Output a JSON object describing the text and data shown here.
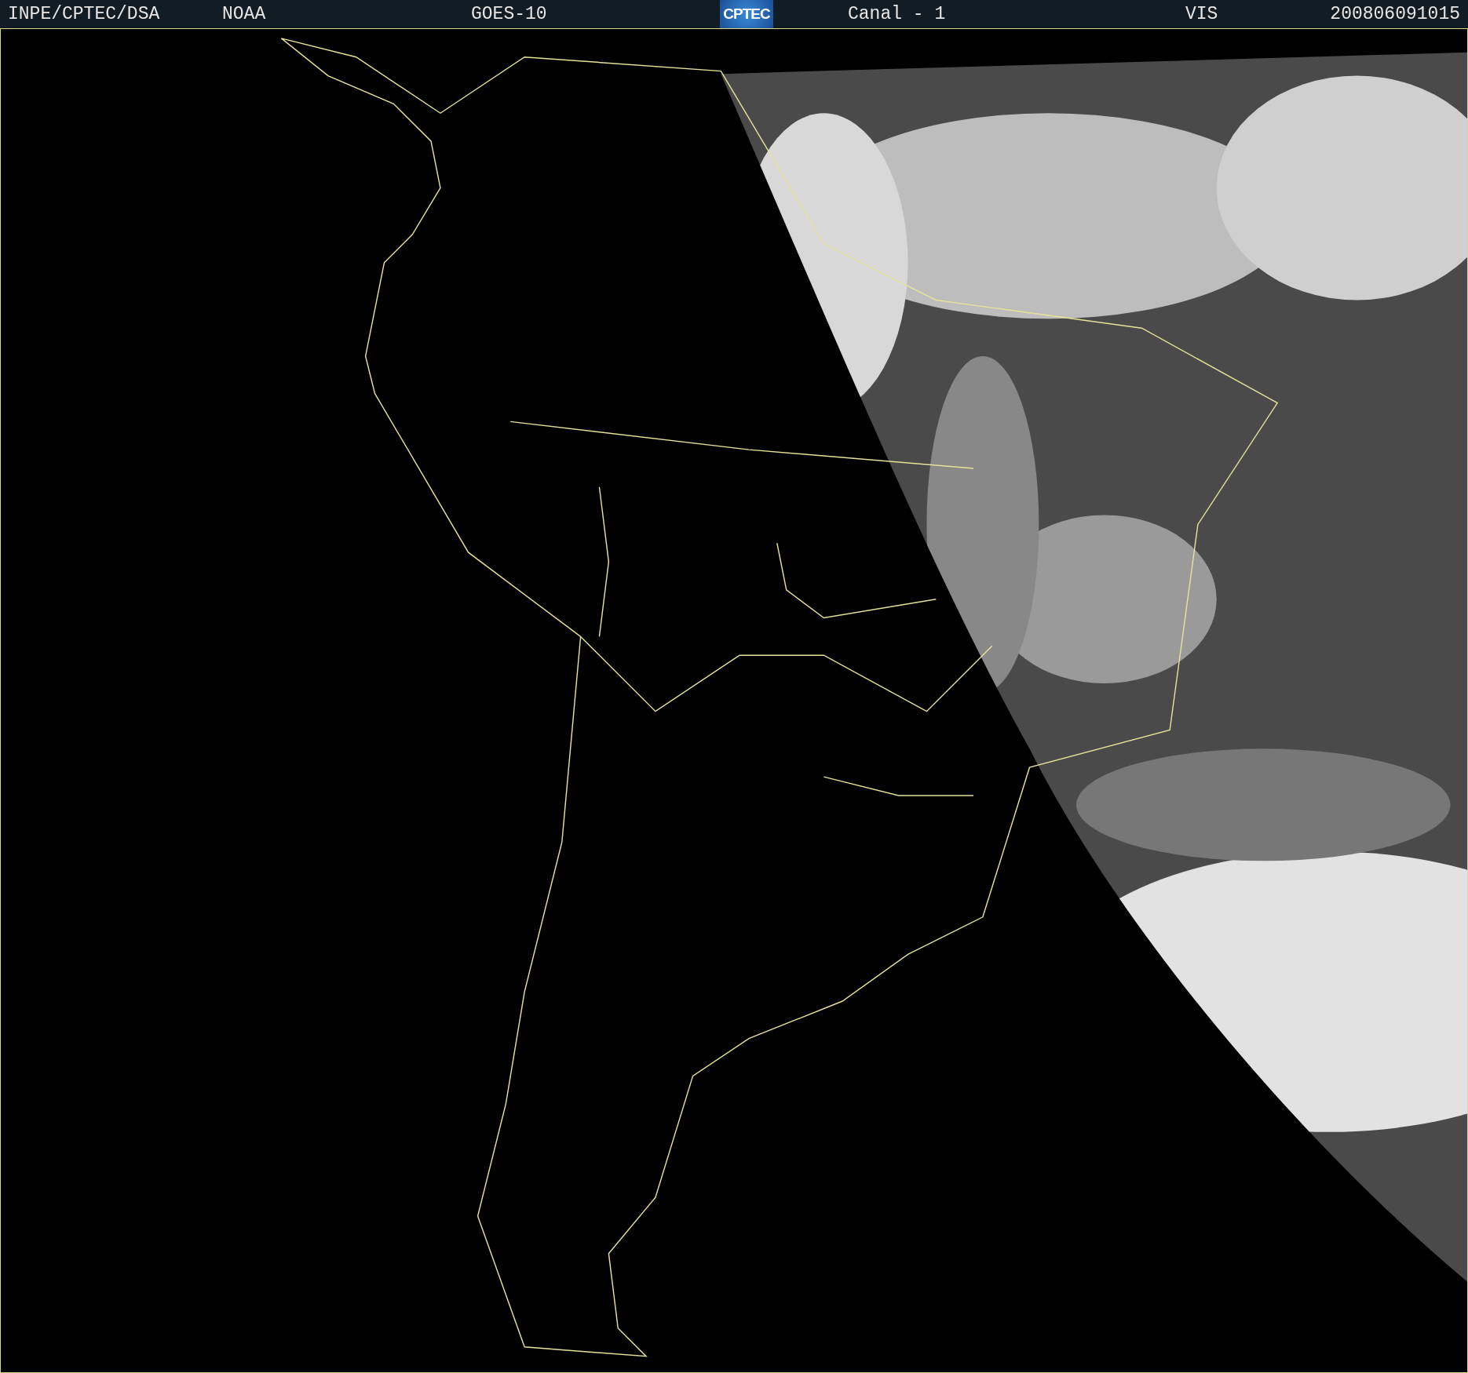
{
  "header": {
    "items": [
      {
        "kind": "text",
        "text": "INPE/CPTEC/DSA"
      },
      {
        "kind": "text",
        "text": "NOAA"
      },
      {
        "kind": "text",
        "text": "GOES-10"
      },
      {
        "kind": "logo",
        "text": "CPTEC"
      },
      {
        "kind": "text",
        "text": "Canal - 1"
      },
      {
        "kind": "text",
        "text": "VIS"
      },
      {
        "kind": "text",
        "text": "200806091015"
      }
    ]
  }
}
